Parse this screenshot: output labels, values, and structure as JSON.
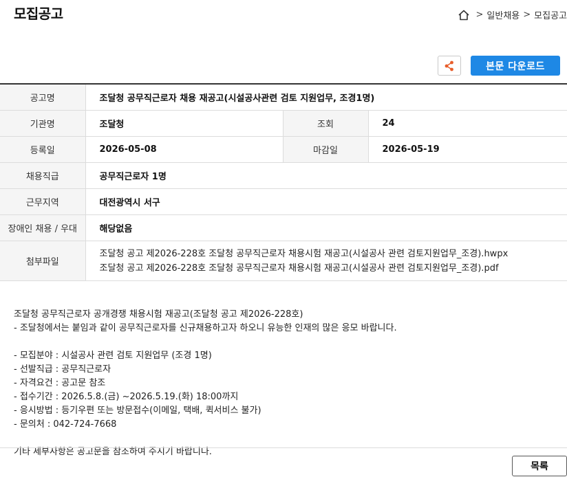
{
  "page": {
    "title": "모집공고"
  },
  "breadcrumb": {
    "items": [
      "일반채용",
      "모집공고"
    ],
    "separator": ">"
  },
  "toolbar": {
    "download_label": "본문 다운로드"
  },
  "info": {
    "labels": {
      "title": "공고명",
      "agency": "기관명",
      "views": "조회",
      "registered": "등록일",
      "deadline": "마감일",
      "position": "채용직급",
      "location": "근무지역",
      "disability": "장애인 채용 / 우대",
      "attachments": "첨부파일"
    },
    "values": {
      "title": "조달청 공무직근로자 채용 재공고(시설공사관련 검토 지원업무, 조경1명)",
      "agency": "조달청",
      "views": "24",
      "registered": "2026-05-08",
      "deadline": "2026-05-19",
      "position": "공무직근로자 1명",
      "location": "대전광역시 서구",
      "disability": "해당없음"
    },
    "attachments": [
      "조달청 공고 제2026-228호 조달청 공무직근로자 채용시험 재공고(시설공사 관련 검토지원업무_조경).hwpx",
      "조달청 공고 제2026-228호 조달청 공무직근로자 채용시험 재공고(시설공사 관련 검토지원업무_조경).pdf"
    ]
  },
  "body": {
    "lines": [
      "조달청 공무직근로자 공개경쟁 채용시험 재공고(조달청 공고 제2026-228호)",
      "- 조달청에서는 붙임과 같이 공무직근로자를 신규채용하고자 하오니 유능한 인재의 많은 응모 바랍니다.",
      "",
      "- 모집분야 : 시설공사 관련 검토 지원업무 (조경 1명)",
      "- 선발직급 : 공무직근로자",
      "- 자격요건 : 공고문 참조",
      "- 접수기간 : 2026.5.8.(금) ~2026.5.19.(화) 18:00까지",
      "- 응시방법 : 등기우편 또는 방문접수(이메일, 택배, 퀵서비스 불가)",
      "- 문의처 : 042-724-7668",
      "",
      "기타 세부사항은 공고문을 참조하여 주시기 바랍니다."
    ]
  },
  "footer": {
    "list_label": "목록"
  },
  "colors": {
    "accent": "#1e88e5",
    "share_icon": "#e85d2a"
  }
}
